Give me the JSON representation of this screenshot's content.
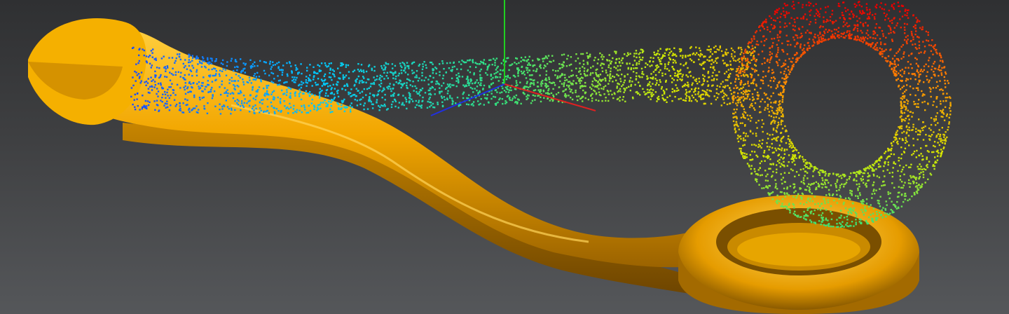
{
  "viewport": {
    "background_top": "#2f3032",
    "background_bottom": "#55575a"
  },
  "mesh_model": {
    "color": "#f0a800",
    "shade_color": "#9a6400",
    "highlight_color": "#ffd25a"
  },
  "point_cloud": {
    "colormap": [
      "#1a4dff",
      "#00c8ff",
      "#35e07a",
      "#d4e600",
      "#ff8a00",
      "#e80000"
    ]
  },
  "axes": {
    "x_color": "#e02020",
    "y_color": "#20d020",
    "z_color": "#2030e0"
  }
}
